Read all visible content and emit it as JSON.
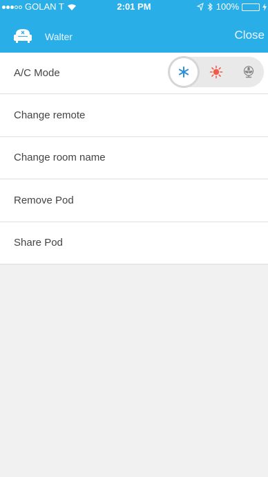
{
  "status_bar": {
    "carrier": "GOLAN T",
    "time": "2:01 PM",
    "battery": "100%",
    "battery_level": 1.0,
    "signal_bars_filled": 3,
    "signal_bars_total": 5
  },
  "nav": {
    "title": "Walter",
    "close_label": "Close"
  },
  "menu": {
    "ac_mode": {
      "label": "A/C Mode",
      "options": [
        "cool-snowflake-icon",
        "heat-sun-icon",
        "fan-icon"
      ],
      "selected": "cool"
    },
    "change_remote": "Change remote",
    "change_room_name": "Change room name",
    "remove_pod": "Remove Pod",
    "share_pod": "Share Pod"
  },
  "colors": {
    "header": "#2aaee8",
    "cool": "#2d8fd6",
    "heat": "#f15a4a",
    "fan": "#888888",
    "background": "#f1f1f1"
  }
}
